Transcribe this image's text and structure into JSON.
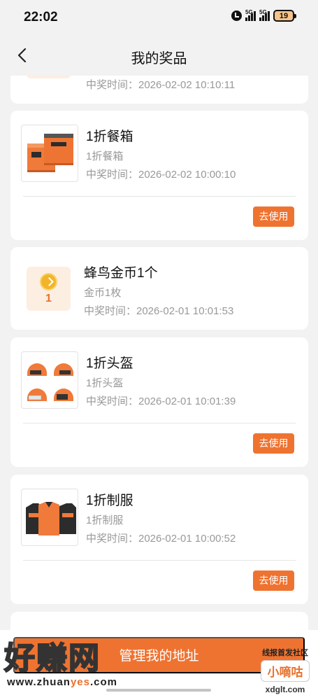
{
  "status_bar": {
    "time": "22:02",
    "network_1": "5G",
    "network_2": "5G",
    "battery": "19"
  },
  "nav": {
    "title": "我的奖品"
  },
  "prizes": [
    {
      "time": "中奖时间：2026-02-02 10:10:11"
    },
    {
      "title": "1折餐箱",
      "subtitle": "1折餐箱",
      "time": "中奖时间：2026-02-02 10:00:10",
      "action": "去使用"
    },
    {
      "title": "蜂鸟金币1个",
      "subtitle": "金币1枚",
      "time": "中奖时间：2026-02-01 10:01:53",
      "coin_count": "1"
    },
    {
      "title": "1折头盔",
      "subtitle": "1折头盔",
      "time": "中奖时间：2026-02-01 10:01:39",
      "action": "去使用"
    },
    {
      "title": "1折制服",
      "subtitle": "1折制服",
      "time": "中奖时间：2026-02-01 10:00:52",
      "action": "去使用"
    }
  ],
  "bottom": {
    "address_button": "管理我的地址"
  },
  "watermark": {
    "left_big": "好赚网",
    "left_url_a": "www.zhuan",
    "left_url_b": "yes",
    "left_url_c": ".com",
    "right_top": "线报首发社区",
    "right_mid": "小嘀咕",
    "right_url": "xdglt.com"
  },
  "colors": {
    "accent": "#ef7330",
    "background": "#f2f2f2",
    "muted_text": "#999999"
  }
}
